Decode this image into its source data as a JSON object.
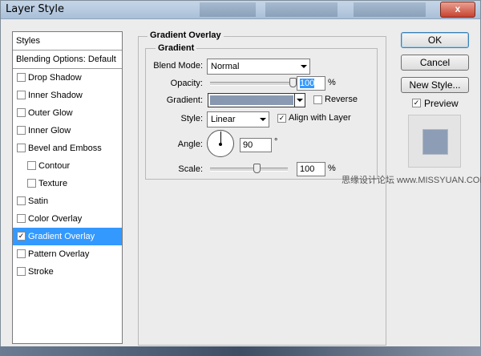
{
  "window": {
    "title": "Layer Style",
    "close_label": "x"
  },
  "styles_panel": {
    "header": "Styles",
    "blending": "Blending Options: Default",
    "items": [
      {
        "label": "Drop Shadow",
        "checked": false,
        "sub": false,
        "selected": false
      },
      {
        "label": "Inner Shadow",
        "checked": false,
        "sub": false,
        "selected": false
      },
      {
        "label": "Outer Glow",
        "checked": false,
        "sub": false,
        "selected": false
      },
      {
        "label": "Inner Glow",
        "checked": false,
        "sub": false,
        "selected": false
      },
      {
        "label": "Bevel and Emboss",
        "checked": false,
        "sub": false,
        "selected": false
      },
      {
        "label": "Contour",
        "checked": false,
        "sub": true,
        "selected": false
      },
      {
        "label": "Texture",
        "checked": false,
        "sub": true,
        "selected": false
      },
      {
        "label": "Satin",
        "checked": false,
        "sub": false,
        "selected": false
      },
      {
        "label": "Color Overlay",
        "checked": false,
        "sub": false,
        "selected": false
      },
      {
        "label": "Gradient Overlay",
        "checked": true,
        "sub": false,
        "selected": true
      },
      {
        "label": "Pattern Overlay",
        "checked": false,
        "sub": false,
        "selected": false
      },
      {
        "label": "Stroke",
        "checked": false,
        "sub": false,
        "selected": false
      }
    ]
  },
  "gradient_overlay": {
    "title": "Gradient Overlay",
    "group_title": "Gradient",
    "blend_mode_label": "Blend Mode:",
    "blend_mode_value": "Normal",
    "opacity_label": "Opacity:",
    "opacity_value": "100",
    "opacity_unit": "%",
    "opacity_fraction": 1.0,
    "gradient_label": "Gradient:",
    "gradient_colors": [
      "#8797b0",
      "#8a9ab3"
    ],
    "reverse_label": "Reverse",
    "reverse_checked": false,
    "style_label": "Style:",
    "style_value": "Linear",
    "align_label": "Align with Layer",
    "align_checked": true,
    "angle_label": "Angle:",
    "angle_value": "90",
    "angle_unit": "°",
    "scale_label": "Scale:",
    "scale_value": "100",
    "scale_unit": "%",
    "scale_fraction": 0.6
  },
  "buttons": {
    "ok": "OK",
    "cancel": "Cancel",
    "new_style": "New Style..."
  },
  "preview": {
    "label": "Preview",
    "checked": true,
    "swatch_color": "#8d9db6"
  },
  "watermark": "思缘设计论坛 www.MISSYUAN.COM",
  "colors": {
    "selection": "#3399ff",
    "dialog_bg": "#ececec",
    "title_bar": "#b6c9df"
  }
}
